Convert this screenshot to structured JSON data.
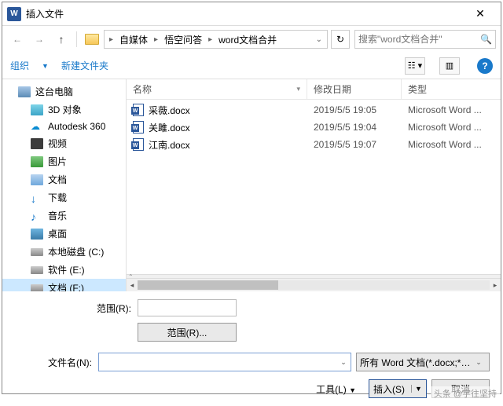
{
  "title": "插入文件",
  "breadcrumb": {
    "items": [
      "自媒体",
      "悟空问答",
      "word文档合并"
    ]
  },
  "search": {
    "placeholder": "搜索\"word文档合并\""
  },
  "toolbar": {
    "organize": "组织",
    "newfolder": "新建文件夹"
  },
  "sidebar": {
    "items": [
      {
        "label": "这台电脑",
        "icon": "pc"
      },
      {
        "label": "3D 对象",
        "icon": "3d"
      },
      {
        "label": "Autodesk 360",
        "icon": "cloud"
      },
      {
        "label": "视频",
        "icon": "video"
      },
      {
        "label": "图片",
        "icon": "img"
      },
      {
        "label": "文档",
        "icon": "doc"
      },
      {
        "label": "下载",
        "icon": "down"
      },
      {
        "label": "音乐",
        "icon": "music"
      },
      {
        "label": "桌面",
        "icon": "desk"
      },
      {
        "label": "本地磁盘 (C:)",
        "icon": "disk"
      },
      {
        "label": "软件 (E:)",
        "icon": "disk"
      },
      {
        "label": "文档 (F:)",
        "icon": "disk"
      }
    ]
  },
  "columns": {
    "name": "名称",
    "date": "修改日期",
    "type": "类型"
  },
  "files": [
    {
      "name": "采薇.docx",
      "date": "2019/5/5 19:05",
      "type": "Microsoft Word ..."
    },
    {
      "name": "关雎.docx",
      "date": "2019/5/5 19:04",
      "type": "Microsoft Word ..."
    },
    {
      "name": "江南.docx",
      "date": "2019/5/5 19:07",
      "type": "Microsoft Word ..."
    }
  ],
  "form": {
    "range_label": "范围(R):",
    "range_button": "范围(R)...",
    "filename_label": "文件名(N):",
    "filter": "所有 Word 文档(*.docx;*.doc",
    "tools": "工具(L)",
    "insert": "插入(S)",
    "cancel": "取消"
  },
  "watermark": "头条 @宇往坚持"
}
